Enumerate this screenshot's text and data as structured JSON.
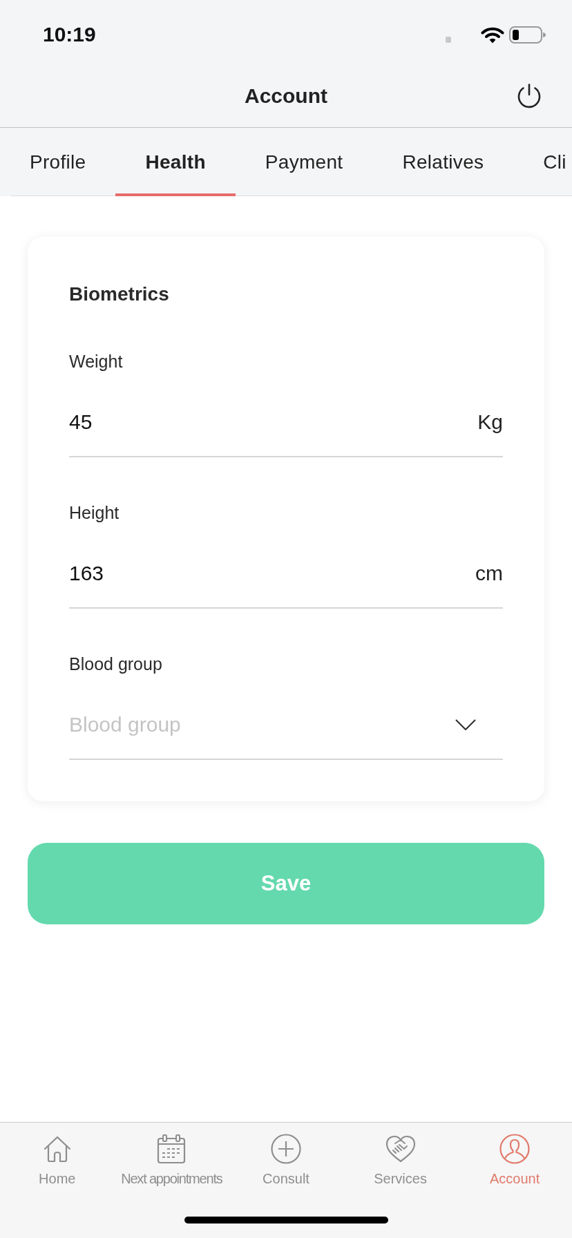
{
  "status_bar": {
    "time": "10:19"
  },
  "header": {
    "title": "Account"
  },
  "tabs": [
    {
      "label": "Profile",
      "selected": false
    },
    {
      "label": "Health",
      "selected": true
    },
    {
      "label": "Payment",
      "selected": false
    },
    {
      "label": "Relatives",
      "selected": false
    },
    {
      "label": "Cli",
      "selected": false
    }
  ],
  "card": {
    "title": "Biometrics",
    "fields": [
      {
        "kind": "input",
        "label": "Weight",
        "value": "45",
        "unit": "Kg"
      },
      {
        "kind": "input",
        "label": "Height",
        "value": "163",
        "unit": "cm"
      },
      {
        "kind": "select",
        "label": "Blood group",
        "placeholder": "Blood group"
      }
    ]
  },
  "save_button": {
    "label": "Save"
  },
  "bottom_nav": [
    {
      "label": "Home",
      "selected": false
    },
    {
      "label": "Next appointments",
      "selected": false
    },
    {
      "label": "Consult",
      "selected": false
    },
    {
      "label": "Services",
      "selected": false
    },
    {
      "label": "Account",
      "selected": true
    }
  ]
}
